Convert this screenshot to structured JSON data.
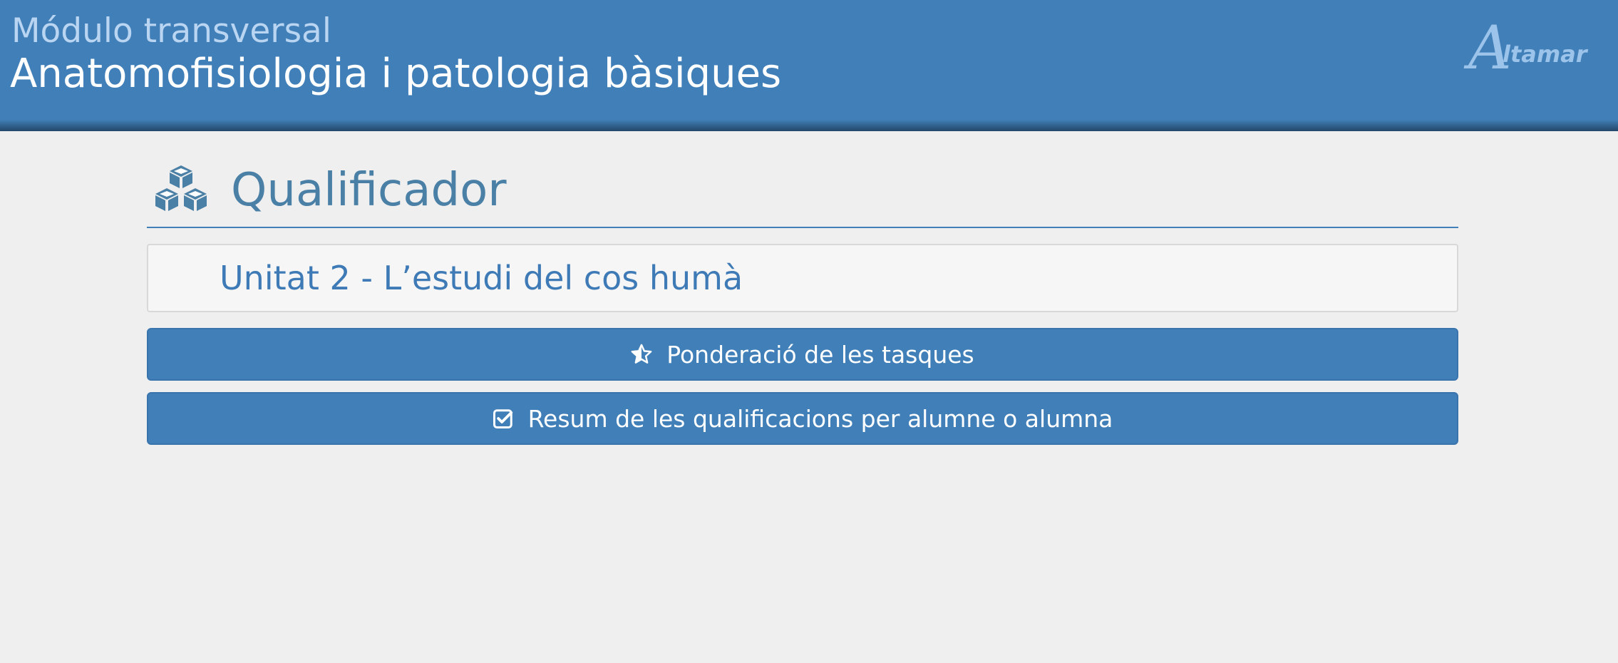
{
  "header": {
    "module_label": "Módulo transversal",
    "course_title": "Anatomofisiologia i patologia bàsiques",
    "brand": {
      "first_letter": "A",
      "rest": "ltamar"
    }
  },
  "section": {
    "icon": "cubes-icon",
    "title": "Qualificador"
  },
  "unit": {
    "title": "Unitat 2 - L’estudi del cos humà"
  },
  "actions": [
    {
      "icon": "star-half-icon",
      "label": "Ponderació de les tasques"
    },
    {
      "icon": "check-square-icon",
      "label": "Resum de les qualificacions per alumne o alumna"
    }
  ],
  "colors": {
    "header_bg": "#417fb8",
    "page_bg": "#efefef",
    "accent_text": "#4a7fa6",
    "button_bg": "#417fb8"
  }
}
